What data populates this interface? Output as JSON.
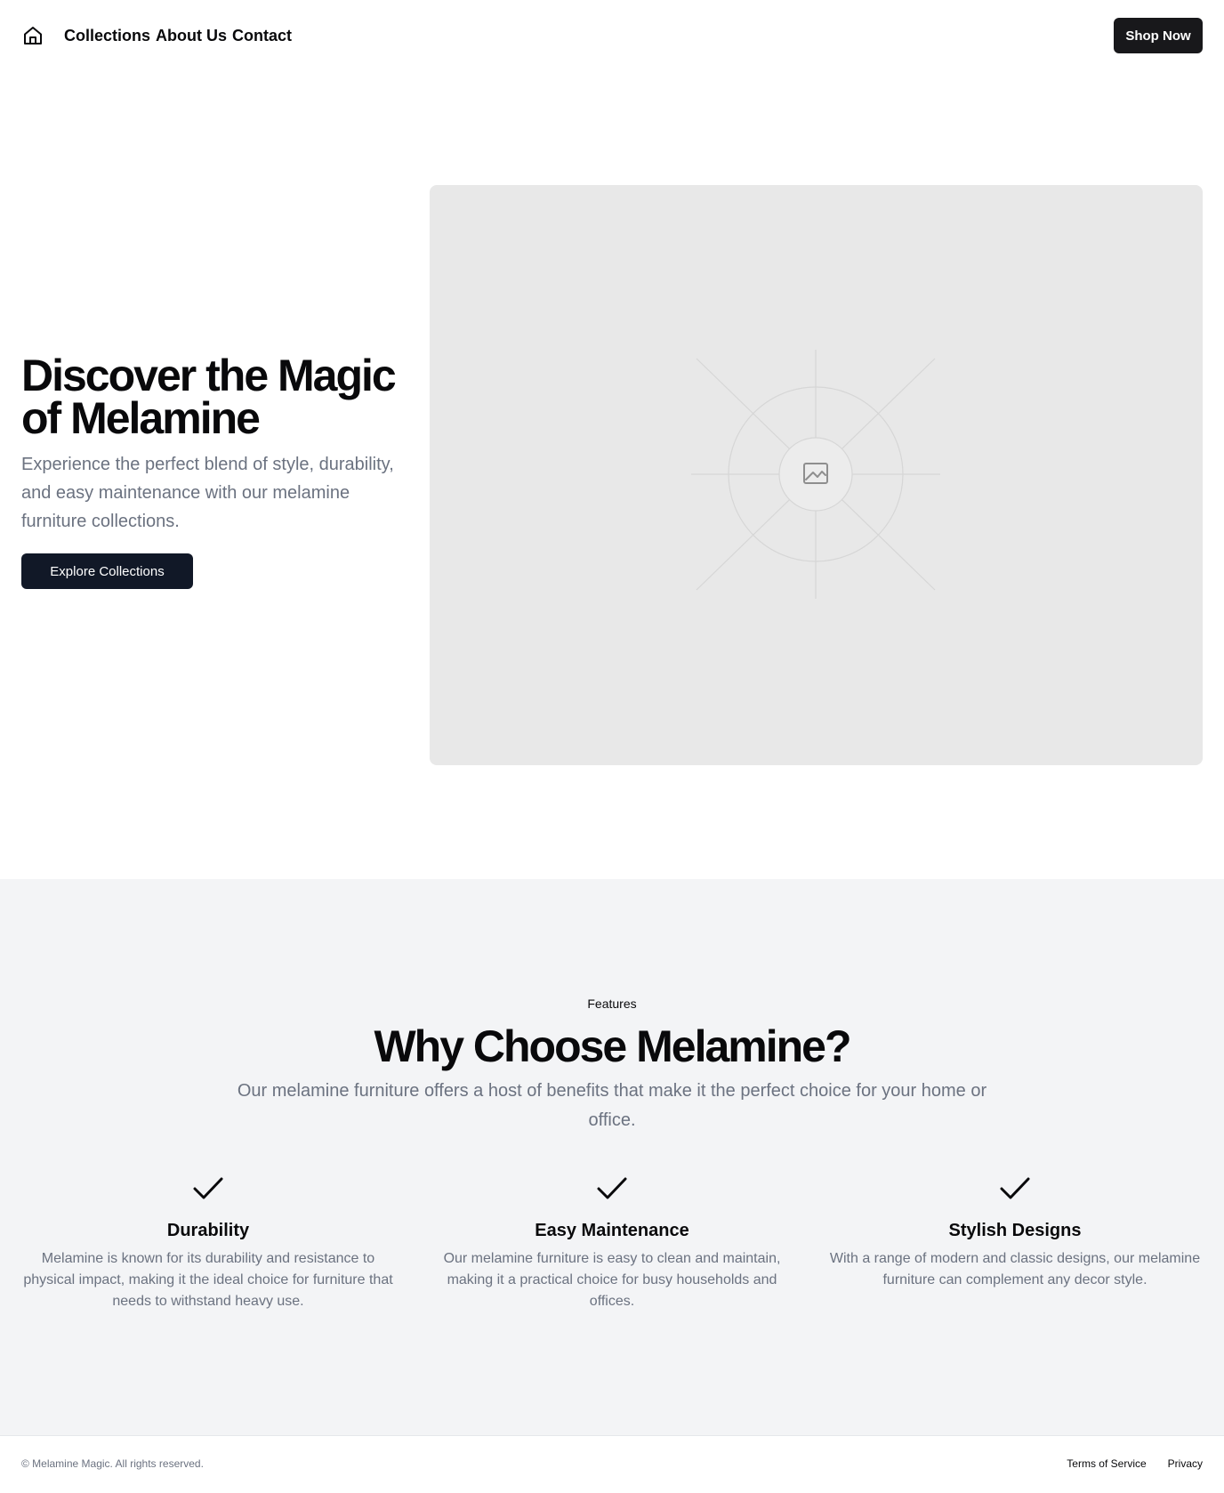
{
  "header": {
    "home_icon": "home-icon",
    "nav": [
      {
        "label": "Collections"
      },
      {
        "label": "About Us"
      },
      {
        "label": "Contact"
      }
    ],
    "shop_button": "Shop Now"
  },
  "hero": {
    "title": "Discover the Magic of Melamine",
    "description": "Experience the perfect blend of style, durability, and easy maintenance with our melamine furniture collections.",
    "cta": "Explore Collections",
    "image_icon": "image-placeholder-icon"
  },
  "features": {
    "eyebrow": "Features",
    "title": "Why Choose Melamine?",
    "description": "Our melamine furniture offers a host of benefits that make it the perfect choice for your home or office.",
    "items": [
      {
        "icon": "check-icon",
        "title": "Durability",
        "text": "Melamine is known for its durability and resistance to physical impact, making it the ideal choice for furniture that needs to withstand heavy use."
      },
      {
        "icon": "check-icon",
        "title": "Easy Maintenance",
        "text": "Our melamine furniture is easy to clean and maintain, making it a practical choice for busy households and offices."
      },
      {
        "icon": "check-icon",
        "title": "Stylish Designs",
        "text": "With a range of modern and classic designs, our melamine furniture can complement any decor style."
      }
    ]
  },
  "footer": {
    "copyright": "© Melamine Magic. All rights reserved.",
    "links": [
      {
        "label": "Terms of Service"
      },
      {
        "label": "Privacy"
      }
    ]
  },
  "colors": {
    "primary_dark": "#18181b",
    "button_navy": "#111827",
    "muted_text": "#6b7280",
    "section_bg": "#f3f4f6",
    "placeholder_bg": "#e8e8e8"
  }
}
